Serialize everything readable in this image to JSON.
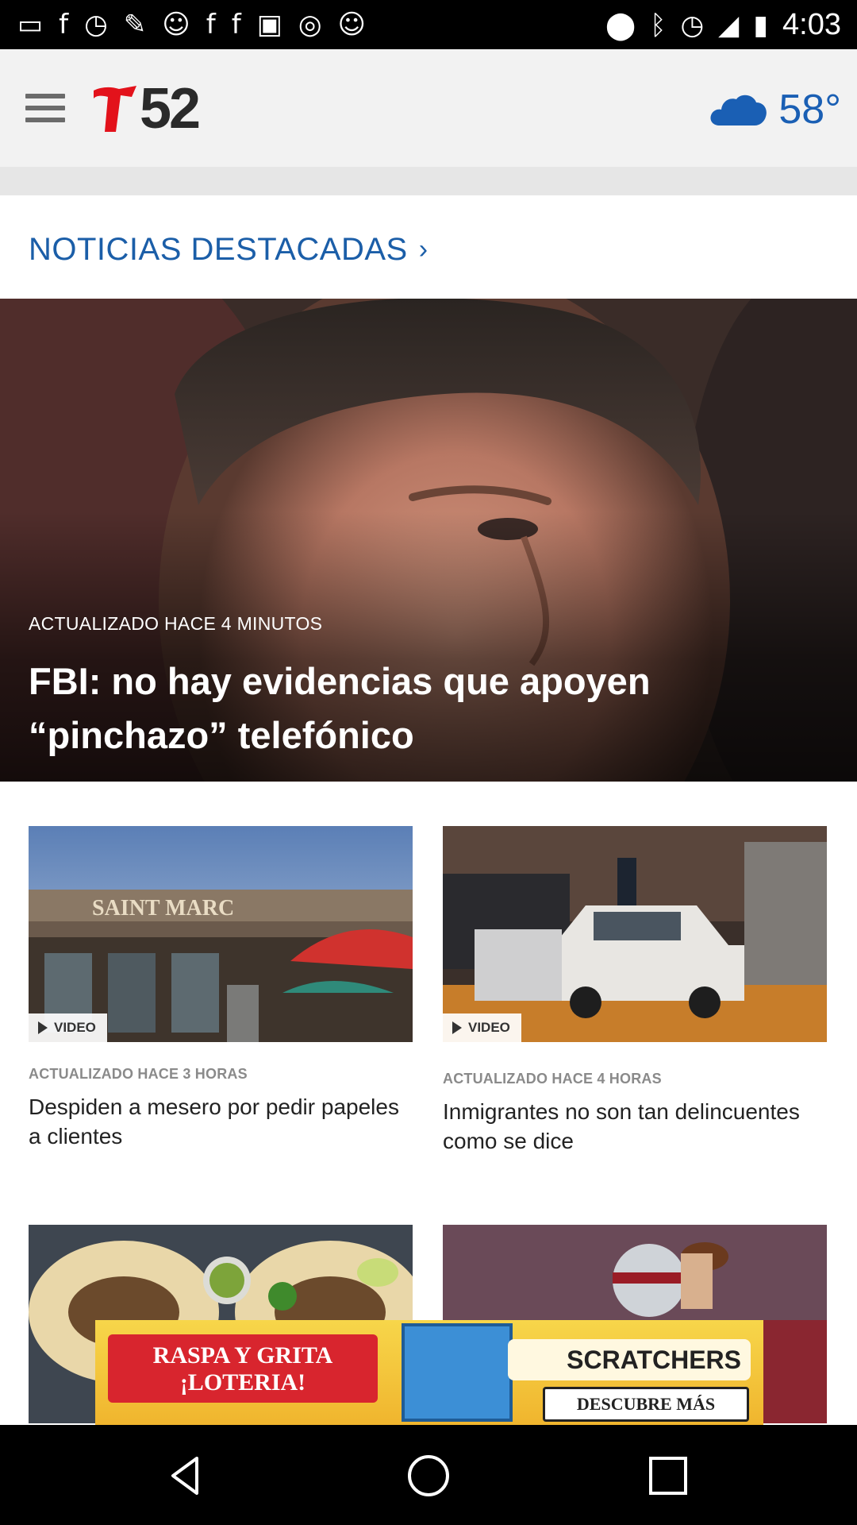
{
  "status_bar": {
    "time": "4:03",
    "left_icons": [
      "message-icon",
      "facebook-icon",
      "timer-icon",
      "wrench-icon",
      "smiley-icon",
      "facebook-icon",
      "facebook-icon",
      "qt-icon",
      "wechat-icon",
      "smiley-icon"
    ],
    "right_icons": [
      "location-icon",
      "bluetooth-icon",
      "alarm-icon",
      "signal-icon",
      "battery-icon"
    ]
  },
  "app_bar": {
    "logo_text": "52",
    "temperature": "58°",
    "weather_icon": "cloud-icon"
  },
  "section": {
    "title": "NOTICIAS DESTACADAS",
    "chevron": "›"
  },
  "hero": {
    "meta": "ACTUALIZADO HACE 4 MINUTOS",
    "headline": "FBI: no hay evidencias que apoyen “pinchazo” telefónico"
  },
  "cards": [
    {
      "badge": "VIDEO",
      "meta": "ACTUALIZADO HACE 3 HORAS",
      "title": "Despiden a mesero por pedir papeles a clientes",
      "sign_text": "SAINT MARC"
    },
    {
      "badge": "VIDEO",
      "meta": "ACTUALIZADO HACE 4 HORAS",
      "title": "Inmigrantes no son tan delincuentes como se dice"
    }
  ],
  "ad": {
    "banner_text": "RASPA Y GRITA ¡LOTERIA!",
    "brand": "SCRATCHERS",
    "cta": "DESCUBRE MÁS"
  },
  "colors": {
    "accent": "#1b5ea8",
    "weather": "#1a5fb4",
    "logo_red": "#e3121b"
  }
}
